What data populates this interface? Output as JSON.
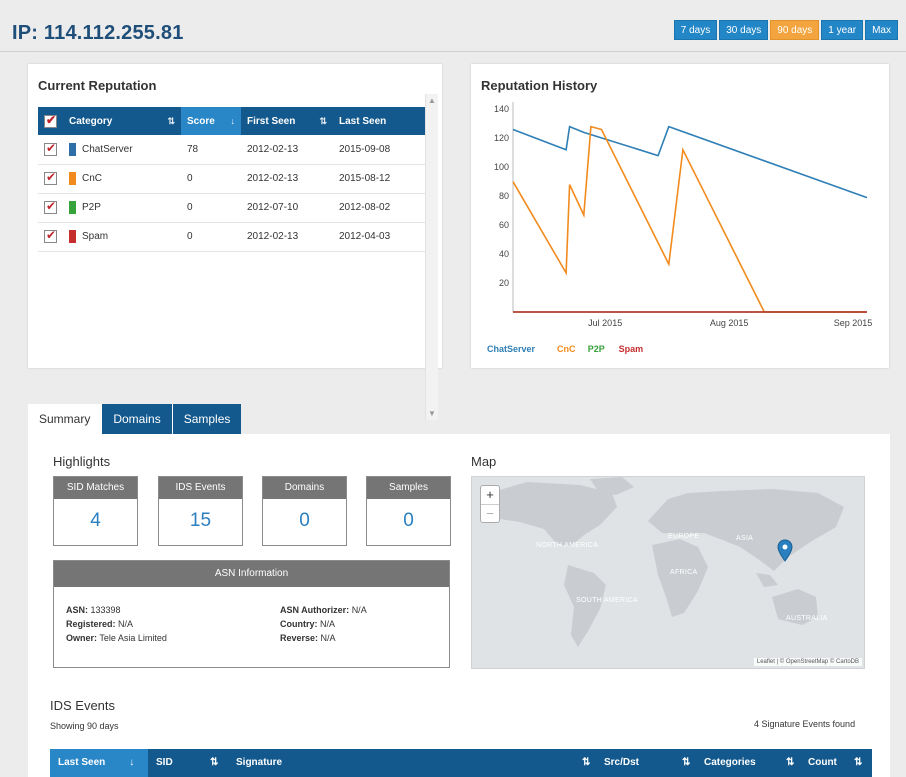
{
  "page": {
    "title": "IP: 114.112.255.81"
  },
  "ranges": [
    "7 days",
    "30 days",
    "90 days",
    "1 year",
    "Max"
  ],
  "reputation": {
    "title": "Current Reputation",
    "columns": [
      "Category",
      "Score",
      "First Seen",
      "Last Seen"
    ],
    "rows": [
      {
        "category": "ChatServer",
        "score": "78",
        "first_seen": "2012-02-13",
        "last_seen": "2015-09-08",
        "color": "#2f6fa8"
      },
      {
        "category": "CnC",
        "score": "0",
        "first_seen": "2012-02-13",
        "last_seen": "2015-08-12",
        "color": "#f28b1e"
      },
      {
        "category": "P2P",
        "score": "0",
        "first_seen": "2012-07-10",
        "last_seen": "2012-08-02",
        "color": "#35a33a"
      },
      {
        "category": "Spam",
        "score": "0",
        "first_seen": "2012-02-13",
        "last_seen": "2012-04-03",
        "color": "#c62d2d"
      }
    ]
  },
  "history": {
    "title": "Reputation History",
    "legend": [
      "ChatServer",
      "CnC",
      "P2P",
      "Spam"
    ]
  },
  "chart_data": {
    "type": "line",
    "title": "Reputation History",
    "x_ticks": [
      "Jul 2015",
      "Aug 2015",
      "Sep 2015"
    ],
    "y_ticks": [
      20,
      40,
      60,
      80,
      100,
      120,
      140
    ],
    "ylim": [
      0,
      145
    ],
    "xlim": [
      0,
      100
    ],
    "grid": false,
    "legend_position": "bottom-left",
    "series": [
      {
        "name": "ChatServer",
        "color": "#2f7fb7",
        "points": [
          [
            0,
            126
          ],
          [
            15,
            112
          ],
          [
            16,
            128
          ],
          [
            20,
            124
          ],
          [
            41,
            108
          ],
          [
            44,
            128
          ],
          [
            100,
            79
          ]
        ]
      },
      {
        "name": "CnC",
        "color": "#f28b1e",
        "points": [
          [
            0,
            90
          ],
          [
            15,
            27
          ],
          [
            16,
            88
          ],
          [
            20,
            67
          ],
          [
            22,
            128
          ],
          [
            25,
            126
          ],
          [
            44,
            33
          ],
          [
            48,
            112
          ],
          [
            71,
            0
          ],
          [
            100,
            0
          ]
        ]
      },
      {
        "name": "P2P",
        "color": "#35a33a",
        "points": [
          [
            0,
            0
          ],
          [
            100,
            0
          ]
        ]
      },
      {
        "name": "Spam",
        "color": "#c62d2d",
        "points": [
          [
            0,
            0
          ],
          [
            100,
            0
          ]
        ]
      }
    ]
  },
  "tabs": [
    "Summary",
    "Domains",
    "Samples"
  ],
  "summary": {
    "highlights_title": "Highlights",
    "map_title": "Map",
    "cards": [
      {
        "label": "SID Matches",
        "value": "4"
      },
      {
        "label": "IDS Events",
        "value": "15"
      },
      {
        "label": "Domains",
        "value": "0"
      },
      {
        "label": "Samples",
        "value": "0"
      }
    ],
    "asn": {
      "title": "ASN Information",
      "asn_label": "ASN:",
      "asn_value": "133398",
      "registered_label": "Registered:",
      "registered_value": "N/A",
      "owner_label": "Owner:",
      "owner_value": "Tele Asia Limited",
      "authorizer_label": "ASN Authorizer:",
      "authorizer_value": "N/A",
      "country_label": "Country:",
      "country_value": "N/A",
      "reverse_label": "Reverse:",
      "reverse_value": "N/A"
    },
    "map": {
      "zoom_in": "+",
      "zoom_out": "−",
      "labels": [
        "NORTH AMERICA",
        "EUROPE",
        "ASIA",
        "AFRICA",
        "SOUTH AMERICA",
        "AUSTRALIA"
      ],
      "attribution": "Leaflet | © OpenStreetMap © CartoDB"
    }
  },
  "ids": {
    "title": "IDS Events",
    "showing": "Showing 90 days",
    "found": "4 Signature Events found",
    "columns": [
      "Last Seen",
      "SID",
      "Signature",
      "Src/Dst",
      "Categories",
      "Count"
    ]
  }
}
